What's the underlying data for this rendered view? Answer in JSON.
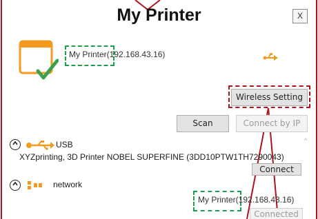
{
  "window": {
    "title": "My Printer",
    "close_label": "X"
  },
  "printer": {
    "name_label": "My Printer(192.168.43.16)",
    "icon": "printer-check-icon"
  },
  "buttons": {
    "wireless_setting": "Wireless Setting",
    "scan": "Scan",
    "connect_by_ip": "Connect by IP"
  },
  "usb_section": {
    "toggle_icon": "chevron-up-icon",
    "label": "USB",
    "device": "XYZprinting, 3D Printer NOBEL SUPERFINE  (3DD10PTW1TH7290043)",
    "connect_label": "Connect"
  },
  "network_section": {
    "toggle_icon": "chevron-up-icon",
    "label": "network",
    "device": "My Printer(192.168.43.16)",
    "connected_label": "Connected"
  },
  "colors": {
    "accent_red": "#b2111b",
    "highlight_green": "#1d9e4a",
    "icon_orange": "#f39a1e"
  }
}
